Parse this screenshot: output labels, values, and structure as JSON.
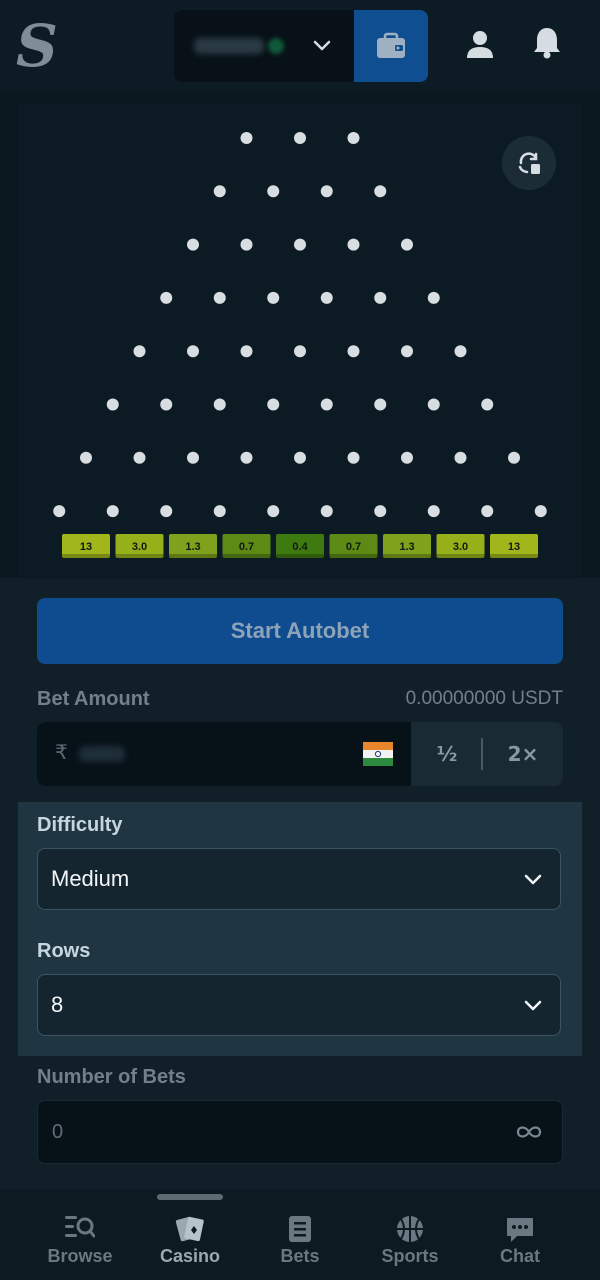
{
  "header": {
    "logo_letter": "S",
    "icons": [
      "chevron-down-icon",
      "wallet-icon",
      "user-icon",
      "bell-icon"
    ]
  },
  "board": {
    "multipliers": [
      "13",
      "3.0",
      "1.3",
      "0.7",
      "0.4",
      "0.7",
      "1.3",
      "3.0",
      "13"
    ],
    "multiplier_colors": [
      "#a1b61b",
      "#96b01a",
      "#7fa11b",
      "#5d8a14",
      "#3f7a10",
      "#5d8a14",
      "#7fa11b",
      "#96b01a",
      "#a1b61b"
    ],
    "peg_color": "#d7dde1"
  },
  "panel": {
    "start_label": "Start Autobet",
    "bet_amount_label": "Bet Amount",
    "bet_amount_value": "0.00000000 USDT",
    "currency_symbol": "₹",
    "half_label": "½",
    "double_label": "2×",
    "difficulty_label": "Difficulty",
    "difficulty_value": "Medium",
    "rows_label": "Rows",
    "rows_value": "8",
    "nbets_label": "Number of Bets",
    "nbets_value": "0"
  },
  "nav": {
    "items": [
      {
        "label": "Browse"
      },
      {
        "label": "Casino"
      },
      {
        "label": "Bets"
      },
      {
        "label": "Sports"
      },
      {
        "label": "Chat"
      }
    ]
  },
  "colors": {
    "accent_blue": "#0f4e91",
    "highlight": "#1f3642"
  }
}
